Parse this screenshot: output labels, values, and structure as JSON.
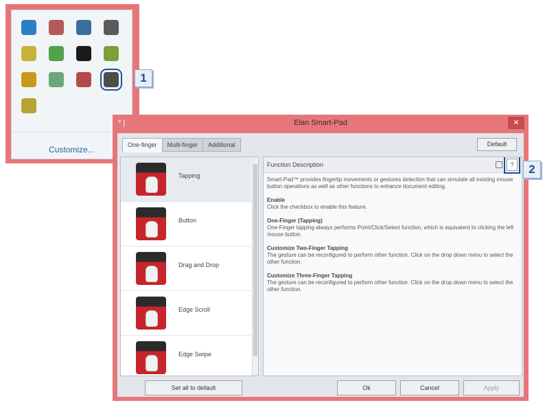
{
  "tray": {
    "customize_label": "Customize...",
    "icons": [
      {
        "name": "network-app-icon",
        "color": "#2d7fc4"
      },
      {
        "name": "speaker-icon",
        "color": "#b45a5a"
      },
      {
        "name": "display-icon",
        "color": "#3a6e9c"
      },
      {
        "name": "printer-icon",
        "color": "#5a5a5a"
      },
      {
        "name": "usb-drive-icon",
        "color": "#c9b23a"
      },
      {
        "name": "green-arrow-icon",
        "color": "#55a04a"
      },
      {
        "name": "black-circle-icon",
        "color": "#1a1a1a"
      },
      {
        "name": "green-leaf-icon",
        "color": "#7aa03a"
      },
      {
        "name": "key-icon",
        "color": "#c99a1a"
      },
      {
        "name": "green-device-icon",
        "color": "#6aa87a"
      },
      {
        "name": "document-flag-icon",
        "color": "#b44a4a"
      },
      {
        "name": "touchpad-icon",
        "color": "#4d4d4d"
      },
      {
        "name": "shield-icon",
        "color": "#b8a236"
      }
    ]
  },
  "callouts": {
    "one": "1",
    "two": "2"
  },
  "dialog": {
    "title": "Elan Smart-Pad",
    "title_left": "* |",
    "close_label": "✕",
    "tabs": [
      "One-finger",
      "Multi-finger",
      "Additional"
    ],
    "default_label": "Default",
    "list_items": [
      "Tapping",
      "Button",
      "Drag and Drop",
      "Edge Scroll",
      "Edge Swipe"
    ],
    "desc_title": "Function Description",
    "help_label": "?",
    "desc_sections": [
      {
        "heading": "",
        "text": "Smart-Pad™ provides fingertip movements or gestures detection that can simulate all existing mouse button operations as well as other functions to enhance document editing."
      },
      {
        "heading": "Enable",
        "text": "Click the checkbox to enable this feature."
      },
      {
        "heading": "One-Finger (Tapping)",
        "text": "One-Finger tapping always performs Point/Click/Select function, which is equivalent to clicking the left mouse button."
      },
      {
        "heading": "Customize Two-Finger Tapping",
        "text": "The gesture can be reconfigured to perform other function. Click on the drop down menu to select the other function."
      },
      {
        "heading": "Customize Three-Finger Tapping",
        "text": "The gesture can be reconfigured to perform other function. Click on the drop down menu to select the other function."
      }
    ],
    "buttons": {
      "set_all_default": "Set all to default",
      "ok": "Ok",
      "cancel": "Cancel",
      "apply": "Apply"
    }
  }
}
